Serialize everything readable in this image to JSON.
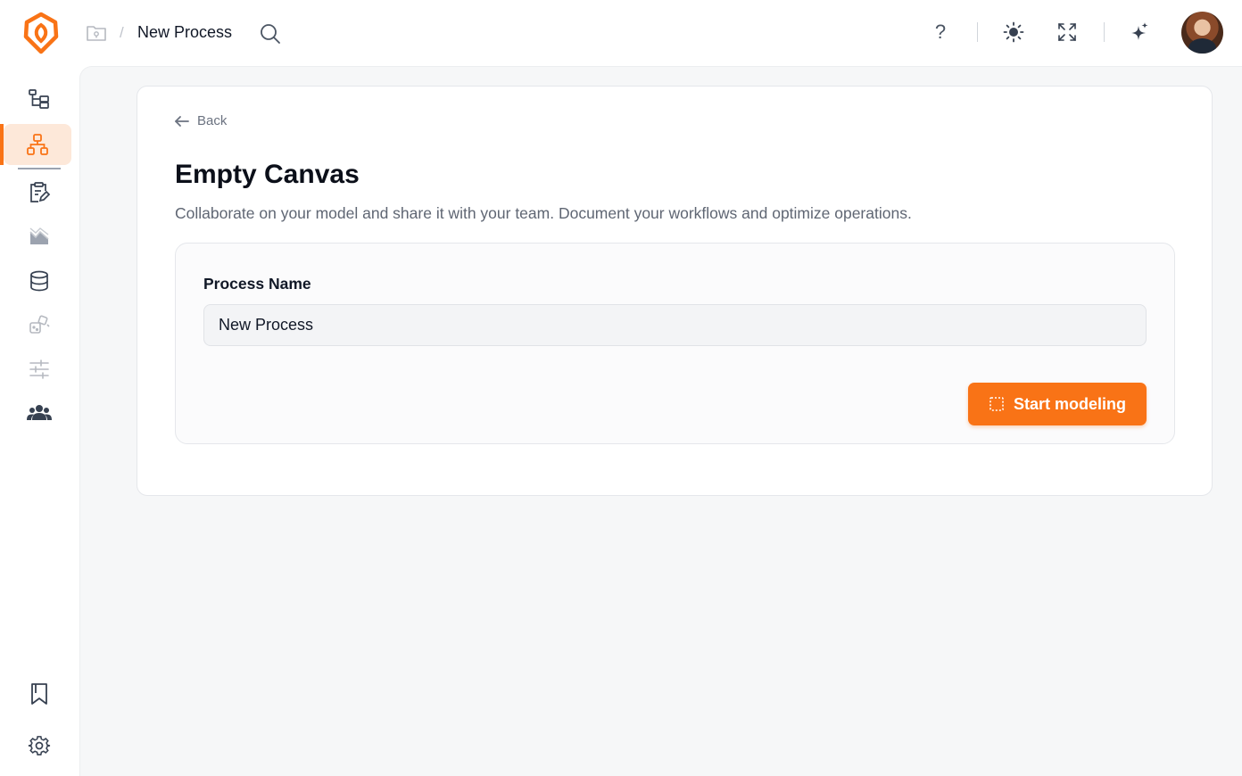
{
  "header": {
    "breadcrumb_title": "New Process",
    "breadcrumb_separator": "/",
    "help_label": "?"
  },
  "sidebar": {
    "items": [
      {
        "icon": "tree-structure-icon"
      },
      {
        "icon": "org-chart-icon",
        "active": true
      },
      {
        "icon": "clipboard-edit-icon"
      },
      {
        "icon": "chart-area-icon"
      },
      {
        "icon": "database-icon"
      },
      {
        "icon": "shapes-icon"
      },
      {
        "icon": "sliders-icon"
      },
      {
        "icon": "users-icon"
      }
    ],
    "bottom_items": [
      {
        "icon": "bookmark-icon"
      },
      {
        "icon": "gear-icon"
      }
    ]
  },
  "main": {
    "back_label": "Back",
    "title": "Empty Canvas",
    "description": "Collaborate on your model and share it with your team. Document your workflows and optimize operations.",
    "form": {
      "process_name_label": "Process Name",
      "process_name_value": "New Process",
      "start_button_label": "Start modeling"
    }
  },
  "colors": {
    "accent": "#f97316",
    "active_bg": "#fde8d9",
    "main_bg": "#f6f7f8"
  }
}
